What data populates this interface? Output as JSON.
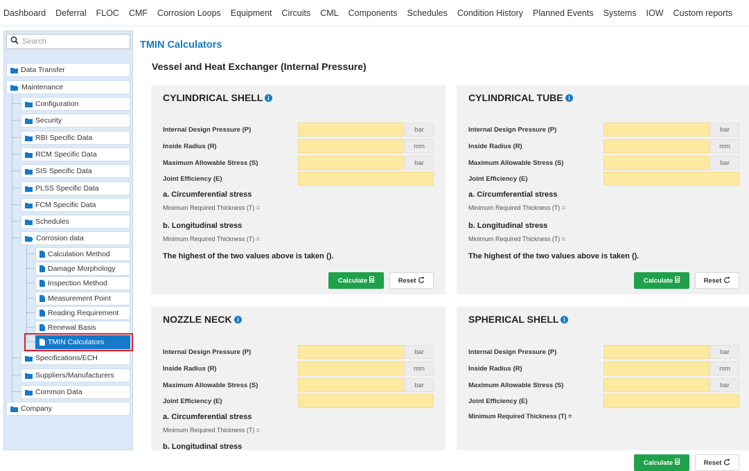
{
  "topnav": [
    "Dashboard",
    "Deferral",
    "FLOC",
    "CMF",
    "Corrosion Loops",
    "Equipment",
    "Circuits",
    "CML",
    "Components",
    "Schedules",
    "Condition History",
    "Planned Events",
    "Systems",
    "IOW",
    "Custom reports"
  ],
  "search": {
    "placeholder": "Search"
  },
  "tree": {
    "data_transfer": "Data Transfer",
    "maintenance": "Maintenance",
    "configuration": "Configuration",
    "security": "Security",
    "rbi": "RBI Specific Data",
    "rcm": "RCM Specific Data",
    "sis": "SIS Specific Data",
    "plss": "PLSS Specific Data",
    "fcm": "FCM Specific Data",
    "schedules": "Schedules",
    "corrosion": "Corrosion data",
    "calc_method": "Calculation Method",
    "damage": "Damage Morphology",
    "inspection": "Inspection Method",
    "measurement": "Measurement Point",
    "reading": "Reading Requirement",
    "renewal": "Renewal Basis",
    "tmin": "TMIN Calculators",
    "specs": "Specifications/ECH",
    "suppliers": "Suppliers/Manufacturers",
    "common": "Common Data",
    "company": "Company"
  },
  "page_title": "TMIN Calculators",
  "section_title": "Vessel and Heat Exchanger (Internal Pressure)",
  "labels": {
    "pressure": "Internal Design Pressure (P)",
    "radius": "Inside Radius (R)",
    "stress": "Maximum Allowable Stress (S)",
    "efficiency": "Joint Efficiency (E)",
    "circ": "a. Circumferential stress",
    "long": "b. Longitudinal stress",
    "min_thick": "Minimum Required Thickness (T) =",
    "highest": "The highest of the two values above is taken ().",
    "calculate": "Calculate",
    "reset": "Reset"
  },
  "units": {
    "bar": "bar",
    "mm": "mm"
  },
  "panels": {
    "cyl_shell": "CYLINDRICAL SHELL",
    "cyl_tube": "CYLINDRICAL TUBE",
    "nozzle": "NOZZLE NECK",
    "spherical": "SPHERICAL SHELL",
    "b_longitudinal_partial": "b. Longitudinal stress"
  },
  "colors": {
    "accent": "#1479c9",
    "calc_button": "#1fa14a",
    "input_fill": "#fde9a0",
    "selected": "#1479c9",
    "highlight": "#e0202a"
  }
}
